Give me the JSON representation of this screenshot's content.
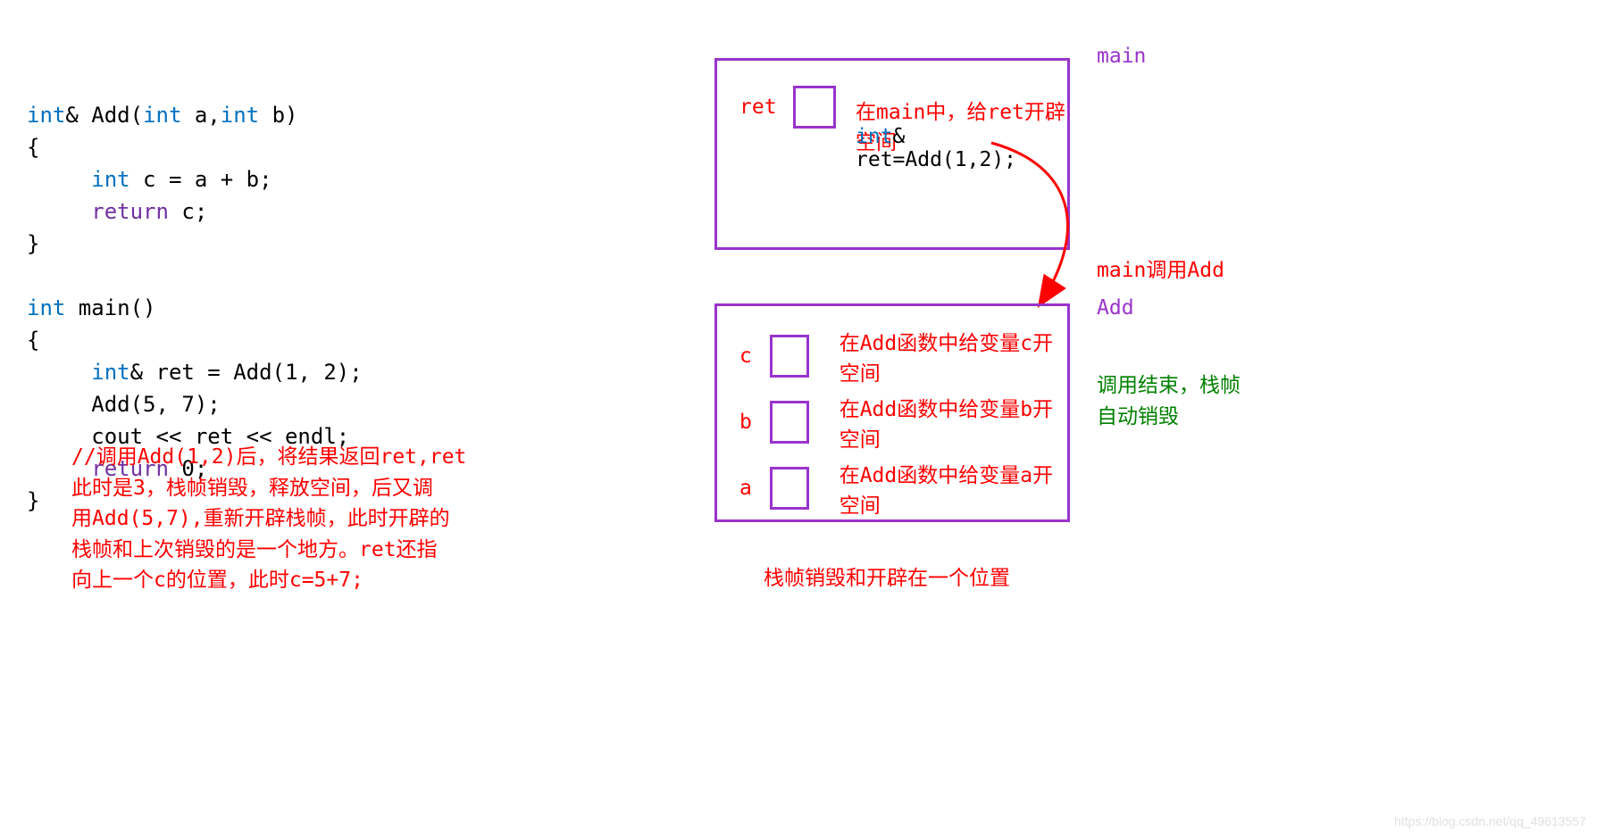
{
  "code": {
    "line1_int": "int",
    "line1_amp": "& Add(",
    "line1_int2": "int",
    "line1_a": " a,",
    "line1_int3": "int",
    "line1_b": " b)",
    "line2": "{",
    "line3_int": "int",
    "line3_rest": " c = a + b;",
    "line4_return": "return",
    "line4_rest": " c;",
    "line5": "}",
    "line6": "",
    "line7_int": "int",
    "line7_rest": " main()",
    "line8": "{",
    "line9_int": "int",
    "line9_rest": "& ret = Add(1, 2);",
    "line10": "     Add(5, 7);",
    "line11": "     cout << ret << endl;",
    "line12_return": "return",
    "line12_rest": " 0;",
    "line13": "}"
  },
  "comment": "//调用Add(1,2)后，将结果返回ret,ret\n此时是3，栈帧销毁，释放空间，后又调\n用Add(5,7),重新开辟栈帧，此时开辟的\n栈帧和上次销毁的是一个地方。ret还指\n向上一个c的位置，此时c=5+7;",
  "main_frame": {
    "title": "main",
    "ret_label": "ret",
    "ret_desc": "在main中，给ret开辟空间",
    "code_int": "int",
    "code_rest": "& ret=Add(1,2);"
  },
  "call_label": "main调用Add",
  "add_frame": {
    "title": "Add",
    "c_label": "c",
    "c_desc": "在Add函数中给变量c开空间",
    "b_label": "b",
    "b_desc": "在Add函数中给变量b开空间",
    "a_label": "a",
    "a_desc": "在Add函数中给变量a开空间"
  },
  "destroy_note": "调用结束，栈帧\n自动销毁",
  "bottom_note": "栈帧销毁和开辟在一个位置",
  "watermark": "https://blog.csdn.net/qq_49613557"
}
